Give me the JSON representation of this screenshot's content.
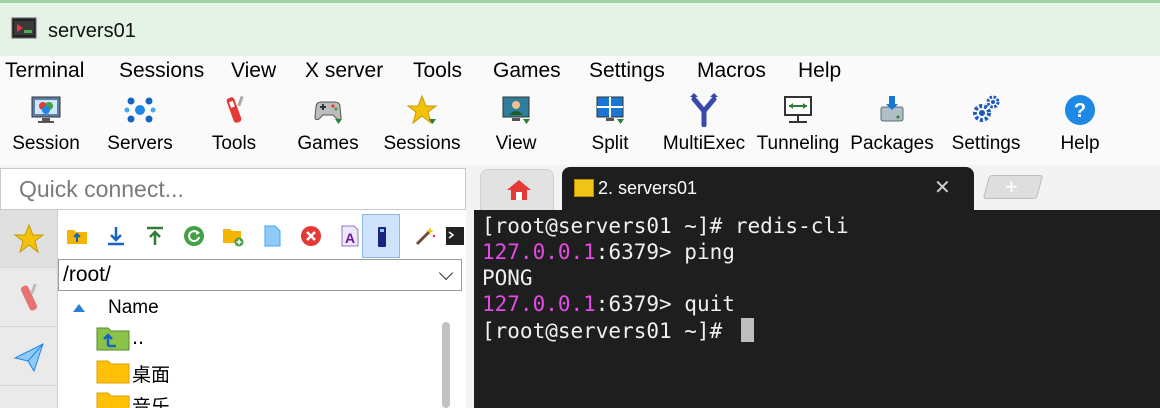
{
  "window": {
    "title": "servers01"
  },
  "menu": [
    "Terminal",
    "Sessions",
    "View",
    "X server",
    "Tools",
    "Games",
    "Settings",
    "Macros",
    "Help"
  ],
  "toolbar": [
    {
      "label": "Session",
      "icon": "session-icon"
    },
    {
      "label": "Servers",
      "icon": "servers-icon"
    },
    {
      "label": "Tools",
      "icon": "tools-icon"
    },
    {
      "label": "Games",
      "icon": "games-icon"
    },
    {
      "label": "Sessions",
      "icon": "star-icon"
    },
    {
      "label": "View",
      "icon": "view-icon"
    },
    {
      "label": "Split",
      "icon": "split-icon"
    },
    {
      "label": "MultiExec",
      "icon": "multiexec-icon"
    },
    {
      "label": "Tunneling",
      "icon": "tunneling-icon"
    },
    {
      "label": "Packages",
      "icon": "packages-icon"
    },
    {
      "label": "Settings",
      "icon": "settings-gear-icon"
    },
    {
      "label": "Help",
      "icon": "help-icon"
    }
  ],
  "quick_connect": {
    "placeholder": "Quick connect..."
  },
  "tabs": {
    "home_icon": "home-icon",
    "active_label": "2. servers01",
    "close_glyph": "✕",
    "new_glyph": "+"
  },
  "file_browser": {
    "path": "/root/",
    "column_name": "Name",
    "items": [
      {
        "name": "..",
        "icon": "parent-folder-icon"
      },
      {
        "name": "桌面",
        "icon": "folder-icon"
      },
      {
        "name": "音乐",
        "icon": "folder-icon"
      }
    ]
  },
  "terminal": {
    "lines": [
      {
        "prefix": "",
        "text": "[root@servers01 ~]# redis-cli"
      },
      {
        "prefix": "127.0.0.1",
        "text": ":6379> ping"
      },
      {
        "prefix": "",
        "text": "PONG"
      },
      {
        "prefix": "127.0.0.1",
        "text": ":6379> quit"
      },
      {
        "prefix": "",
        "text": "[root@servers01 ~]# "
      }
    ],
    "colors": {
      "background": "#1e1e1e",
      "prompt_ip": "#e44ae6",
      "text": "#f0f0f0"
    }
  }
}
